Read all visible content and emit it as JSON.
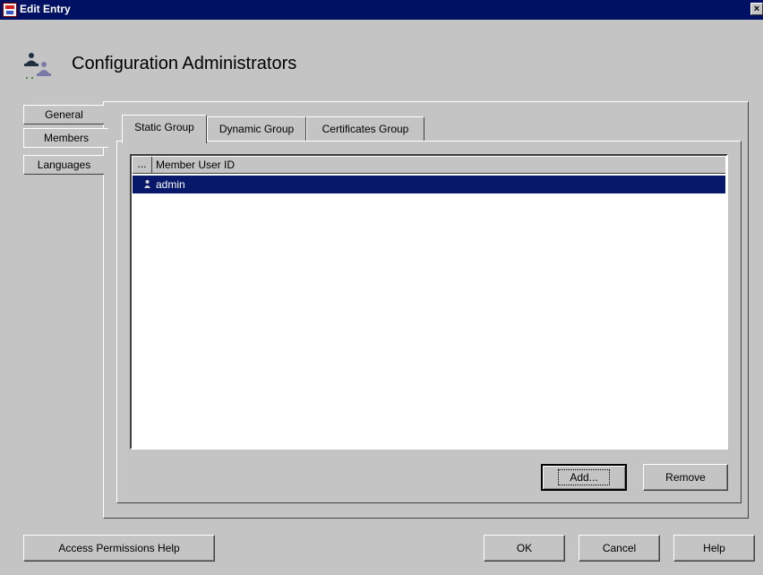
{
  "window": {
    "title": "Edit Entry",
    "close_glyph": "×"
  },
  "heading": {
    "icon": "group-users-icon",
    "text": "Configuration Administrators"
  },
  "side_tabs": [
    {
      "label": "General",
      "selected": false
    },
    {
      "label": "Members",
      "selected": true
    },
    {
      "label": "Languages",
      "selected": false
    }
  ],
  "group_tabs": [
    {
      "label": "Static Group",
      "selected": true
    },
    {
      "label": "Dynamic Group",
      "selected": false
    },
    {
      "label": "Certificates Group",
      "selected": false
    }
  ],
  "member_list": {
    "header_dots": "...",
    "column_header": "Member User ID",
    "rows": [
      {
        "icon": "user-icon",
        "label": "admin",
        "selected": true
      }
    ]
  },
  "list_buttons": {
    "add": "Add...",
    "remove": "Remove"
  },
  "footer": {
    "access_help": "Access Permissions Help",
    "ok": "OK",
    "cancel": "Cancel",
    "help": "Help"
  },
  "colors": {
    "titlebar": "#001063",
    "selection": "#07186b",
    "panel": "#c4c4c4"
  }
}
